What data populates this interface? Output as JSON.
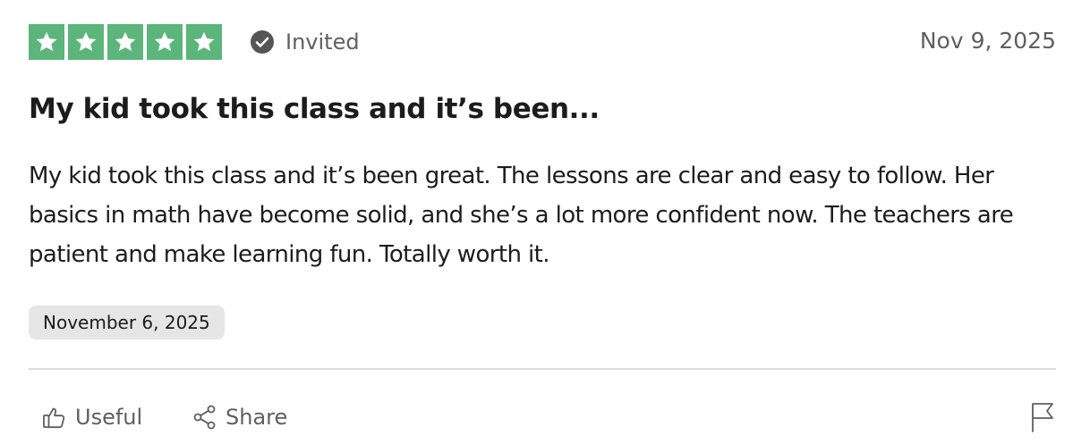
{
  "review": {
    "rating": 5,
    "max_rating": 5,
    "star_color": "#5cb57a",
    "verification_label": "Invited",
    "date_posted": "Nov 9, 2025",
    "title": "My kid took this class and it’s been...",
    "body": "My kid took this class and it’s been great. The lessons are clear and easy to follow. Her basics in math have become solid, and she’s a lot more confident now. The teachers are patient and make learning fun. Totally worth it.",
    "experience_date": "November 6, 2025"
  },
  "actions": {
    "useful_label": "Useful",
    "share_label": "Share",
    "useful_icon": "thumbs-up-icon",
    "share_icon": "share-icon",
    "report_icon": "flag-icon"
  }
}
